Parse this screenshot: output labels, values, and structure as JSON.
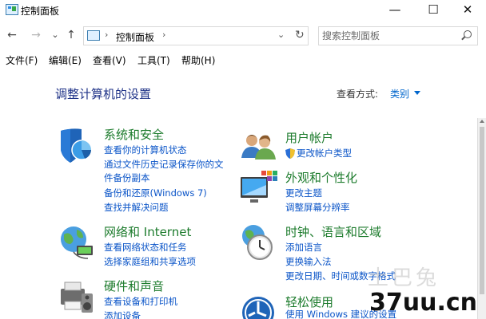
{
  "window": {
    "title": "控制面板",
    "minimize": "—",
    "maximize": "☐",
    "close": "✕"
  },
  "nav": {
    "back": "←",
    "forward": "→",
    "history": "⌄",
    "up": "↑"
  },
  "address": {
    "crumb": "控制面板",
    "separator": "›",
    "dropdown": "⌄",
    "refresh": "↻"
  },
  "search": {
    "placeholder": "搜索控制面板"
  },
  "menu": [
    {
      "label": "文件(F)"
    },
    {
      "label": "编辑(E)"
    },
    {
      "label": "查看(V)"
    },
    {
      "label": "工具(T)"
    },
    {
      "label": "帮助(H)"
    }
  ],
  "main": {
    "title": "调整计算机的设置",
    "view_label": "查看方式:",
    "view_value": "类别"
  },
  "categories": {
    "system": {
      "title": "系统和安全",
      "icon": "shield-pie-icon",
      "links": [
        "查看你的计算机状态",
        "通过文件历史记录保存你的文",
        "件备份副本",
        "备份和还原(Windows 7)",
        "查找并解决问题"
      ]
    },
    "network": {
      "title": "网络和 Internet",
      "icon": "globe-network-icon",
      "links": [
        "查看网络状态和任务",
        "选择家庭组和共享选项"
      ]
    },
    "hardware": {
      "title": "硬件和声音",
      "icon": "printer-speaker-icon",
      "links": [
        "查看设备和打印机",
        "添加设备"
      ]
    },
    "users": {
      "title": "用户帐户",
      "icon": "users-icon",
      "links": [
        "更改帐户类型"
      ]
    },
    "appearance": {
      "title": "外观和个性化",
      "icon": "monitor-palette-icon",
      "links": [
        "更改主题",
        "调整屏幕分辨率"
      ]
    },
    "clock": {
      "title": "时钟、语言和区域",
      "icon": "clock-globe-icon",
      "links": [
        "添加语言",
        "更换输入法",
        "更改日期、时间或数字格式"
      ]
    },
    "access": {
      "title": "轻松使用",
      "icon": "ease-of-access-icon",
      "links": [
        "使用 Windows 建议的设置"
      ]
    }
  },
  "watermark": {
    "text1": "土巴兔",
    "text2": "37uu.cn"
  }
}
